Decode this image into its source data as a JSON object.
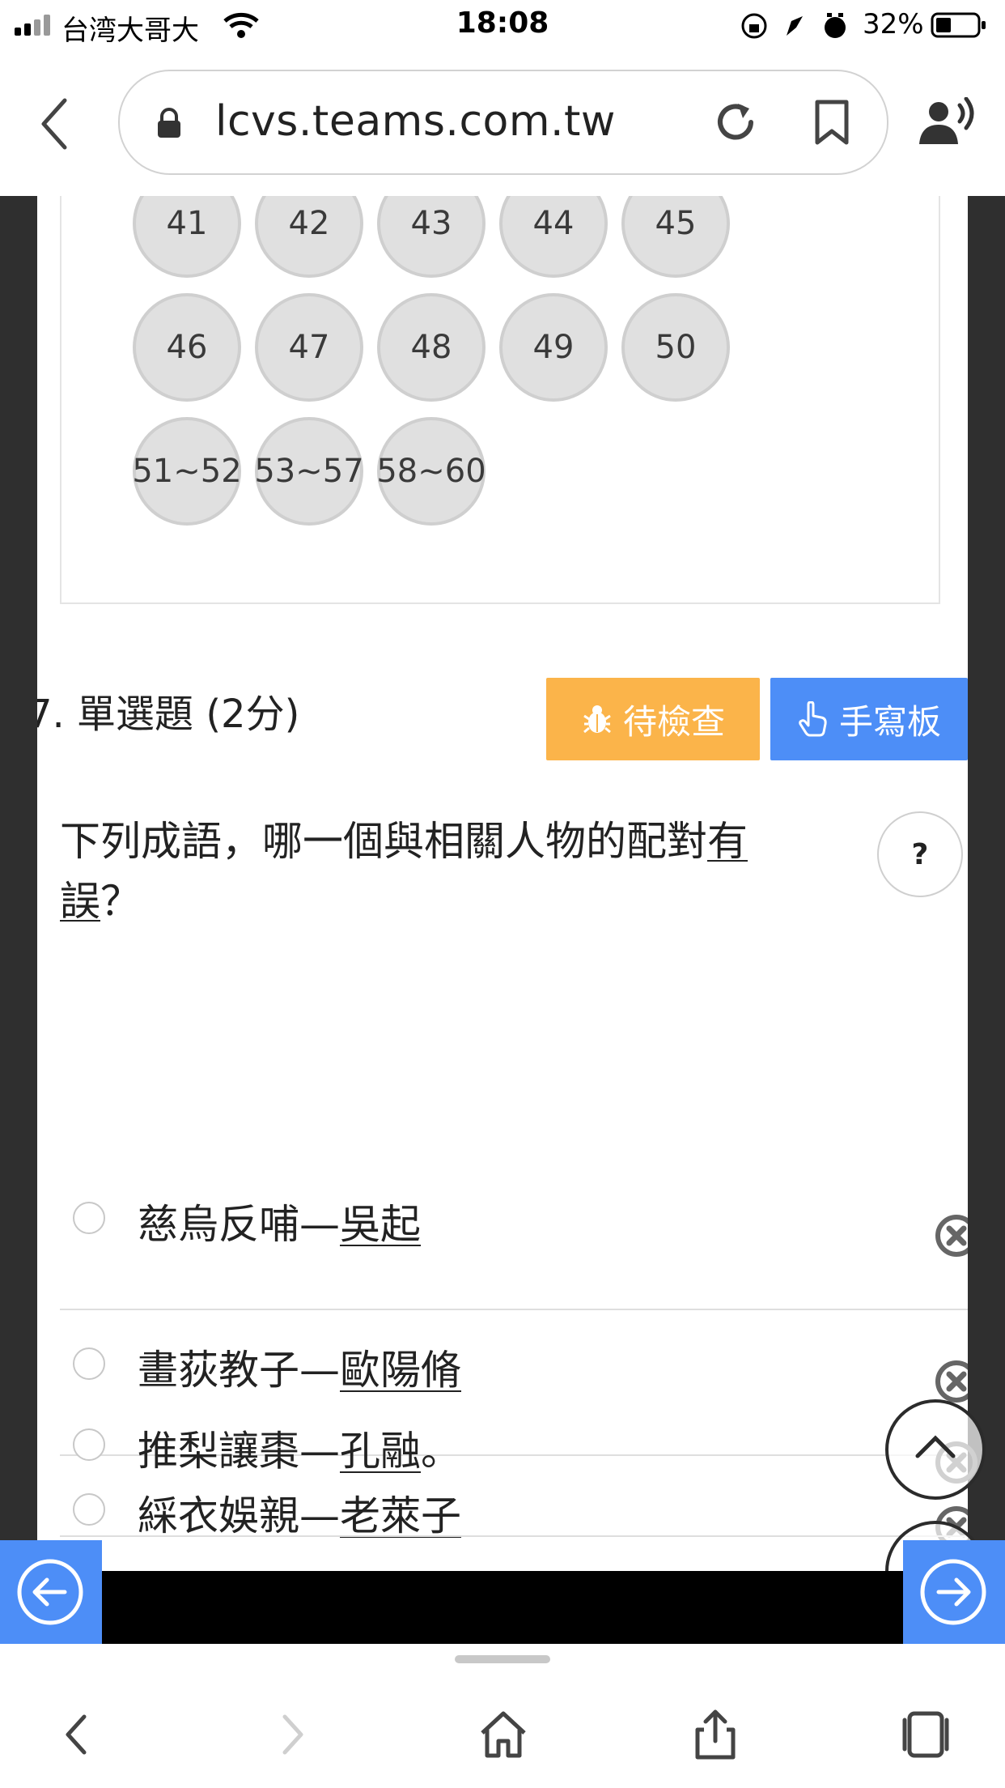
{
  "status": {
    "carrier": "台湾大哥大",
    "time": "18:08",
    "battery": "32%"
  },
  "browser": {
    "url": "lcvs.teams.com.tw"
  },
  "question_nav": {
    "buttons": [
      "41",
      "42",
      "43",
      "44",
      "45",
      "46",
      "47",
      "48",
      "49",
      "50",
      "51~52",
      "53~57",
      "58~60"
    ]
  },
  "question": {
    "title": "7.  單選題 (2分)",
    "check_label": "待檢查",
    "handwrite_label": "手寫板",
    "stem_pre": "下列成語，哪一個與相關人物的配對",
    "stem_underlined": "有誤",
    "stem_post": "？",
    "help_label": "?",
    "options": [
      {
        "idiom": "慈烏反哺—",
        "person": "吳起",
        "suffix": ""
      },
      {
        "idiom": "畫荻教子—",
        "person": "歐陽脩",
        "suffix": ""
      },
      {
        "idiom": "綵衣娛親—",
        "person": "老萊子",
        "suffix": ""
      },
      {
        "idiom": "推梨讓棗—",
        "person": "孔融",
        "suffix": "。"
      }
    ]
  },
  "colors": {
    "check_button": "#fbb44a",
    "handwrite_button": "#4d8ef7",
    "nav_arrows": "#4d8ef7"
  },
  "icons": [
    "signal-icon",
    "wifi-icon",
    "lock-icon",
    "reload-icon",
    "bookmark-icon",
    "speaker-icon",
    "bug-icon",
    "hand-pointer-icon",
    "help-icon",
    "remove-icon",
    "chevron-up-icon",
    "arrow-left-icon",
    "arrow-right-icon",
    "back-icon",
    "forward-icon",
    "home-icon",
    "share-icon",
    "tabs-icon"
  ]
}
